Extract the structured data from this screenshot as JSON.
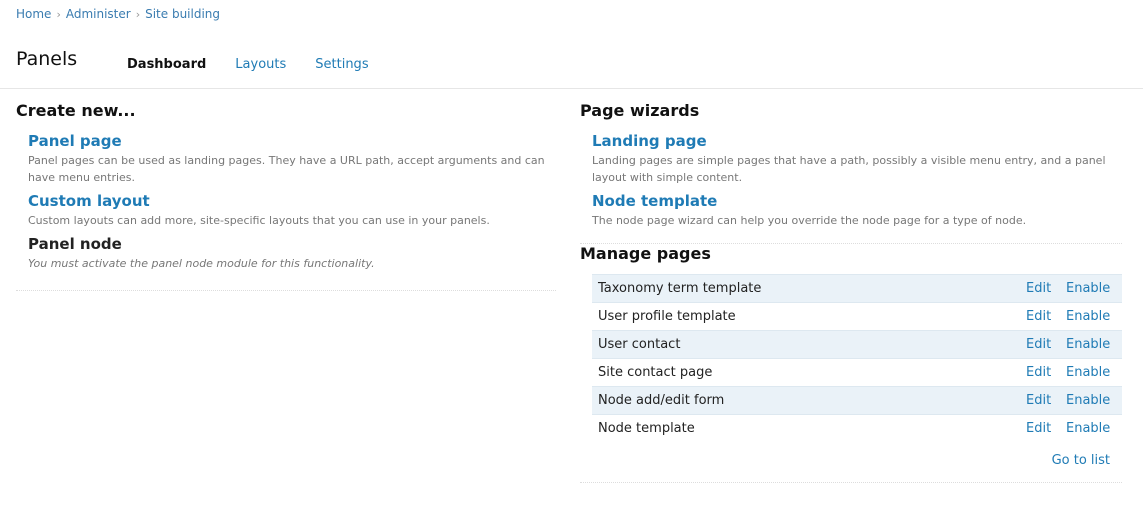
{
  "breadcrumb": [
    "Home",
    "Administer",
    "Site building"
  ],
  "page_title": "Panels",
  "tabs": [
    {
      "label": "Dashboard",
      "active": true
    },
    {
      "label": "Layouts",
      "active": false
    },
    {
      "label": "Settings",
      "active": false
    }
  ],
  "create_new": {
    "title": "Create new...",
    "items": [
      {
        "title": "Panel page",
        "desc": "Panel pages can be used as landing pages. They have a URL path, accept arguments and can have menu entries.",
        "enabled": true
      },
      {
        "title": "Custom layout",
        "desc": "Custom layouts can add more, site-specific layouts that you can use in your panels.",
        "enabled": true
      },
      {
        "title": "Panel node",
        "desc": "You must activate the panel node module for this functionality.",
        "enabled": false
      }
    ]
  },
  "page_wizards": {
    "title": "Page wizards",
    "items": [
      {
        "title": "Landing page",
        "desc": "Landing pages are simple pages that have a path, possibly a visible menu entry, and a panel layout with simple content."
      },
      {
        "title": "Node template",
        "desc": "The node page wizard can help you override the node page for a type of node."
      }
    ]
  },
  "manage_pages": {
    "title": "Manage pages",
    "rows": [
      {
        "name": "Taxonomy term template",
        "edit": "Edit",
        "enable": "Enable"
      },
      {
        "name": "User profile template",
        "edit": "Edit",
        "enable": "Enable"
      },
      {
        "name": "User contact",
        "edit": "Edit",
        "enable": "Enable"
      },
      {
        "name": "Site contact page",
        "edit": "Edit",
        "enable": "Enable"
      },
      {
        "name": "Node add/edit form",
        "edit": "Edit",
        "enable": "Enable"
      },
      {
        "name": "Node template",
        "edit": "Edit",
        "enable": "Enable"
      }
    ],
    "go_to_list": "Go to list"
  },
  "colors": {
    "link": "#1f7bb5",
    "row_stripe": "#eaf2f8"
  }
}
